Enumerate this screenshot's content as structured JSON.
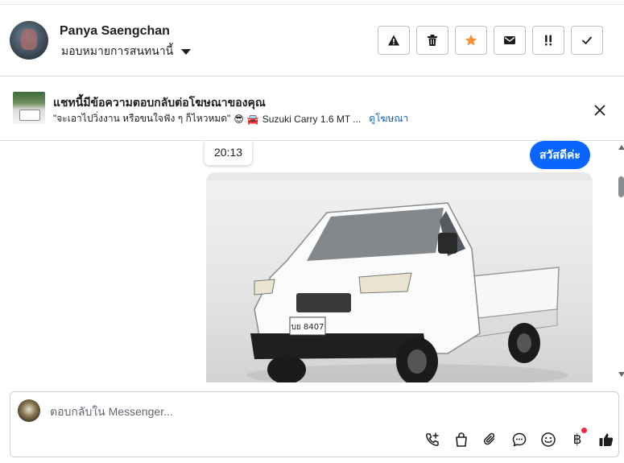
{
  "header": {
    "contact_name": "Panya Saengchan",
    "assign_label": "มอบหมายการสนทนานี้",
    "actions": [
      {
        "name": "report-button",
        "icon": "warning-icon"
      },
      {
        "name": "delete-button",
        "icon": "trash-icon"
      },
      {
        "name": "star-button",
        "icon": "star-icon",
        "color": "#f7923b"
      },
      {
        "name": "mark-unread-button",
        "icon": "envelope-icon"
      },
      {
        "name": "follow-up-button",
        "icon": "exclamation-icon"
      },
      {
        "name": "mark-done-button",
        "icon": "check-icon"
      }
    ]
  },
  "ad_banner": {
    "title": "แชทนี้มีข้อความตอบกลับต่อโฆษณาของคุณ",
    "subtitle_text": "\"จะเอาไปวิ่งงาน หรือขนใจฟัง ๆ ก็ไหวหมด\"",
    "subtitle_emoji_1": "😎",
    "subtitle_emoji_2": "🚘",
    "subtitle_ad": "Suzuki Carry 1.6 MT ...",
    "view_ad_link": "ดูโฆษณา"
  },
  "chat": {
    "timestamp_tooltip": "20:13",
    "messages": [
      {
        "sender": "page",
        "text": "สวัสดีค่ะ"
      }
    ],
    "image_plate": "บย 8407"
  },
  "composer": {
    "placeholder": "ตอบกลับใน Messenger...",
    "tools": [
      "phone-plus-icon",
      "shopping-bag-icon",
      "paperclip-icon",
      "chat-bubble-icon",
      "smiley-icon",
      "baht-icon",
      "thumbs-up-icon"
    ],
    "baht_symbol": "฿"
  },
  "colors": {
    "accent": "#0866ff",
    "star": "#f7923b",
    "notification": "#f02849",
    "link": "#0a66c2"
  }
}
